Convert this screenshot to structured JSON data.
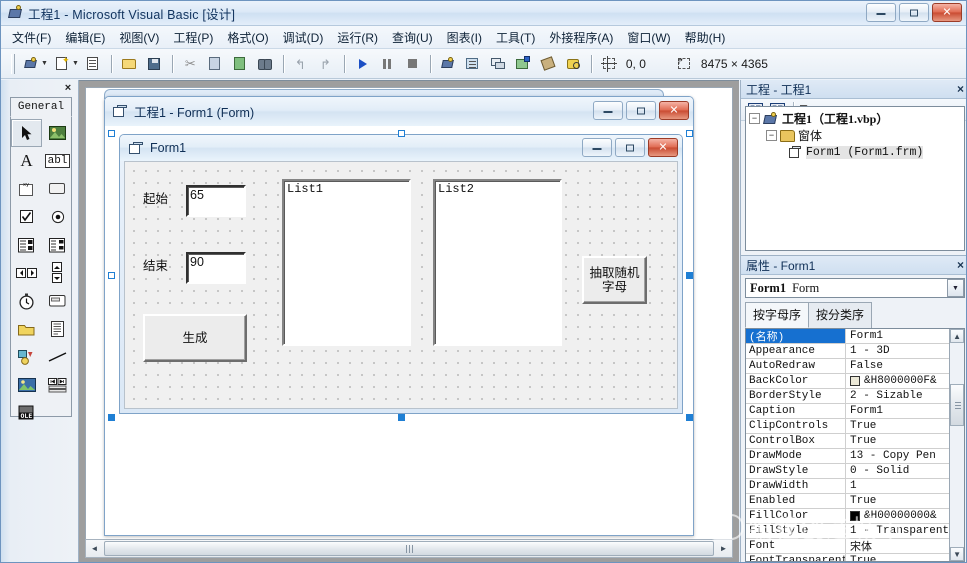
{
  "window": {
    "title": "工程1 - Microsoft Visual Basic [设计]",
    "icon": "vb-project-icon",
    "minimize_label": "最小化",
    "maximize_label": "最大化",
    "close_label": "关闭"
  },
  "menubar": {
    "items": [
      {
        "label": "文件(F)"
      },
      {
        "label": "编辑(E)"
      },
      {
        "label": "视图(V)"
      },
      {
        "label": "工程(P)"
      },
      {
        "label": "格式(O)"
      },
      {
        "label": "调试(D)"
      },
      {
        "label": "运行(R)"
      },
      {
        "label": "查询(U)"
      },
      {
        "label": "图表(I)"
      },
      {
        "label": "工具(T)"
      },
      {
        "label": "外接程序(A)"
      },
      {
        "label": "窗口(W)"
      },
      {
        "label": "帮助(H)"
      }
    ]
  },
  "toolbar": {
    "buttons": [
      {
        "name": "add-standard-exe",
        "icon": "project-icon",
        "dropdown": true
      },
      {
        "name": "add-form",
        "icon": "add-form-icon",
        "dropdown": true
      },
      {
        "name": "menu-editor",
        "icon": "menu-editor-icon"
      },
      {
        "name": "open-project",
        "icon": "folder-open-icon"
      },
      {
        "name": "save-project",
        "icon": "floppy-disk-icon"
      },
      {
        "name": "cut",
        "icon": "scissors-icon"
      },
      {
        "name": "copy",
        "icon": "copy-icon"
      },
      {
        "name": "paste",
        "icon": "paste-icon"
      },
      {
        "name": "find",
        "icon": "binoculars-icon"
      },
      {
        "name": "undo",
        "icon": "undo-icon"
      },
      {
        "name": "redo",
        "icon": "redo-icon"
      },
      {
        "name": "start",
        "icon": "play-icon"
      },
      {
        "name": "break",
        "icon": "pause-icon"
      },
      {
        "name": "end",
        "icon": "stop-icon"
      },
      {
        "name": "project-explorer",
        "icon": "project-explorer-icon"
      },
      {
        "name": "properties-window",
        "icon": "properties-icon"
      },
      {
        "name": "form-layout-window",
        "icon": "form-layout-icon"
      },
      {
        "name": "object-browser",
        "icon": "object-browser-icon"
      },
      {
        "name": "toolbox",
        "icon": "toolbox-icon"
      },
      {
        "name": "data-view-window",
        "icon": "data-view-icon"
      }
    ],
    "position_icon": "position-icon",
    "position_value": "0, 0",
    "size_icon": "size-icon",
    "size_value": "8475 × 4365"
  },
  "toolbox": {
    "close_label": "×",
    "tab_label": "General",
    "tools": [
      {
        "name": "pointer-tool",
        "icon": "arrow-pointer-icon",
        "selected": true
      },
      {
        "name": "picturebox-tool",
        "icon": "picturebox-icon"
      },
      {
        "name": "label-tool",
        "icon": "label-A-icon"
      },
      {
        "name": "textbox-tool",
        "icon": "textbox-abl-icon"
      },
      {
        "name": "frame-tool",
        "icon": "frame-xy-icon"
      },
      {
        "name": "commandbutton-tool",
        "icon": "command-button-icon"
      },
      {
        "name": "checkbox-tool",
        "icon": "checkbox-icon"
      },
      {
        "name": "optionbutton-tool",
        "icon": "radio-icon"
      },
      {
        "name": "combobox-tool",
        "icon": "combobox-icon"
      },
      {
        "name": "listbox-tool",
        "icon": "listbox-icon"
      },
      {
        "name": "hscrollbar-tool",
        "icon": "hscrollbar-icon"
      },
      {
        "name": "vscrollbar-tool",
        "icon": "vscrollbar-icon"
      },
      {
        "name": "timer-tool",
        "icon": "timer-clock-icon"
      },
      {
        "name": "drivelistbox-tool",
        "icon": "drive-listbox-icon"
      },
      {
        "name": "dirlistbox-tool",
        "icon": "dir-listbox-folder-icon"
      },
      {
        "name": "filelistbox-tool",
        "icon": "file-listbox-icon"
      },
      {
        "name": "shape-tool",
        "icon": "shape-icon"
      },
      {
        "name": "line-tool",
        "icon": "line-icon"
      },
      {
        "name": "image-tool",
        "icon": "image-icon"
      },
      {
        "name": "data-tool",
        "icon": "data-control-icon"
      },
      {
        "name": "ole-tool",
        "icon": "ole-icon"
      }
    ]
  },
  "designer": {
    "title": "工程1 - Form1 (Form)",
    "icon": "form-icon",
    "minimize_label": "最小化",
    "maximize_label": "最大化",
    "close_label": "关闭",
    "form": {
      "title": "Form1",
      "icon": "form-icon",
      "minimize_label": "最小化",
      "maximize_label": "最大化",
      "close_label": "关闭",
      "controls": {
        "label_start": "起始",
        "text_start_value": "65",
        "label_end": "结束",
        "text_end_value": "90",
        "button_generate": "生成",
        "list1_caption": "List1",
        "list2_caption": "List2",
        "button_random": "抽取随机\n字母",
        "button_random_line1": "抽取随机",
        "button_random_line2": "字母"
      }
    },
    "hscrollbar": {
      "left_arrow": "◄",
      "right_arrow": "►"
    }
  },
  "project_explorer": {
    "title": "工程 - 工程1",
    "close_label": "×",
    "toolbar": [
      {
        "name": "view-code-button",
        "icon": "view-code-icon"
      },
      {
        "name": "view-object-button",
        "icon": "view-object-icon"
      },
      {
        "name": "toggle-folders-button",
        "icon": "folder-toggle-icon"
      }
    ],
    "tree": [
      {
        "level": 0,
        "expander": "−",
        "icon": "project-icon",
        "label": "工程1（工程1.vbp）",
        "style": "bold-serif"
      },
      {
        "level": 1,
        "expander": "−",
        "icon": "folder-icon",
        "label": "窗体",
        "style": "cn"
      },
      {
        "level": 2,
        "expander": "",
        "icon": "form-icon",
        "label": "Form1 (Form1.frm)",
        "style": "mono-selected"
      }
    ]
  },
  "properties": {
    "title": "属性 - Form1",
    "close_label": "×",
    "object_name": "Form1",
    "object_type": "Form",
    "dropdown_icon": "chevron-down-icon",
    "tabs": [
      {
        "label": "按字母序",
        "active": true
      },
      {
        "label": "按分类序",
        "active": false
      }
    ],
    "rows": [
      {
        "key": "(名称)",
        "value": "Form1",
        "selected": true
      },
      {
        "key": "Appearance",
        "value": "1 - 3D"
      },
      {
        "key": "AutoRedraw",
        "value": "False"
      },
      {
        "key": "BackColor",
        "value": "&H8000000F&",
        "swatch": "#ece9d8"
      },
      {
        "key": "BorderStyle",
        "value": "2 - Sizable"
      },
      {
        "key": "Caption",
        "value": "Form1"
      },
      {
        "key": "ClipControls",
        "value": "True"
      },
      {
        "key": "ControlBox",
        "value": "True"
      },
      {
        "key": "DrawMode",
        "value": "13 - Copy Pen"
      },
      {
        "key": "DrawStyle",
        "value": "0 - Solid"
      },
      {
        "key": "DrawWidth",
        "value": "1"
      },
      {
        "key": "Enabled",
        "value": "True"
      },
      {
        "key": "FillColor",
        "value": "&H00000000&",
        "swatch": "#000000"
      },
      {
        "key": "FillStyle",
        "value": "1 - Transparent"
      },
      {
        "key": "Font",
        "value": "宋体"
      },
      {
        "key": "FontTransparent",
        "value": "True"
      }
    ],
    "scrollbar": {
      "up": "▲",
      "down": "▼"
    }
  },
  "watermark": {
    "text": "编程创造城市",
    "badge": "logo"
  },
  "colors": {
    "accent": "#1f7fd4",
    "titlebar_text": "#11335e",
    "close_button": "#c94b32",
    "selection_blue": "#1670d0",
    "form_canvas": "#f0f0f0"
  }
}
